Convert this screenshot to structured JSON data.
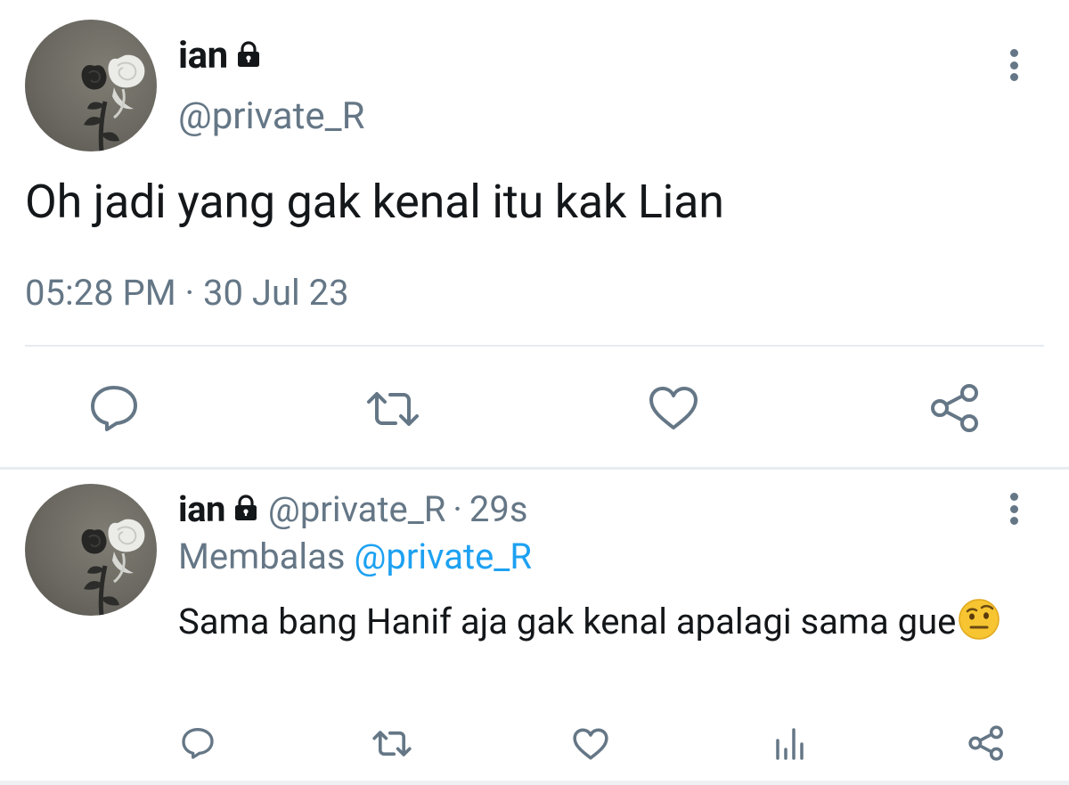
{
  "main_tweet": {
    "display_name": "ian",
    "handle": "@private_R",
    "text": "Oh jadi yang gak kenal itu kak Lian",
    "time": "05:28 PM",
    "separator": "·",
    "date": "30 Jul 23",
    "icons": [
      "lock-icon",
      "more-vertical-icon",
      "reply-icon",
      "retweet-icon",
      "like-icon",
      "share-icon"
    ]
  },
  "reply_tweet": {
    "display_name": "ian",
    "handle": "@private_R",
    "separator": "·",
    "time_ago": "29s",
    "replying_label": "Membalas",
    "replying_to": "@private_R",
    "text": "Sama bang Hanif aja gak kenal apalagi sama gue",
    "emoji": "🤨",
    "icons": [
      "lock-icon",
      "more-vertical-icon",
      "reply-icon",
      "retweet-icon",
      "like-icon",
      "analytics-icon",
      "share-icon"
    ]
  },
  "colors": {
    "text_primary": "#14171a",
    "text_secondary": "#657786",
    "link": "#1da1f2",
    "divider": "#e6ecf0",
    "avatar_bg": "#6b6961"
  }
}
